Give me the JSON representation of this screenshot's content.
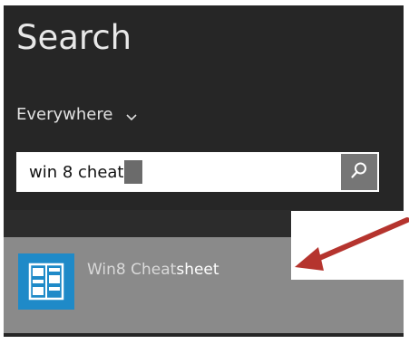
{
  "search_pane": {
    "title": "Search",
    "scope_label": "Everywhere",
    "query": "win 8 cheat",
    "search_button_icon": "magnifier-icon"
  },
  "results": [
    {
      "app_name_prefix": "Win8 Cheat",
      "app_name_match": "sheet",
      "icon": "app-tile-icon"
    }
  ],
  "colors": {
    "pane_background": "#262626",
    "result_highlight": "#8a8a8a",
    "tile_blue": "#1f8ac8",
    "arrow_red": "#b5342e"
  }
}
